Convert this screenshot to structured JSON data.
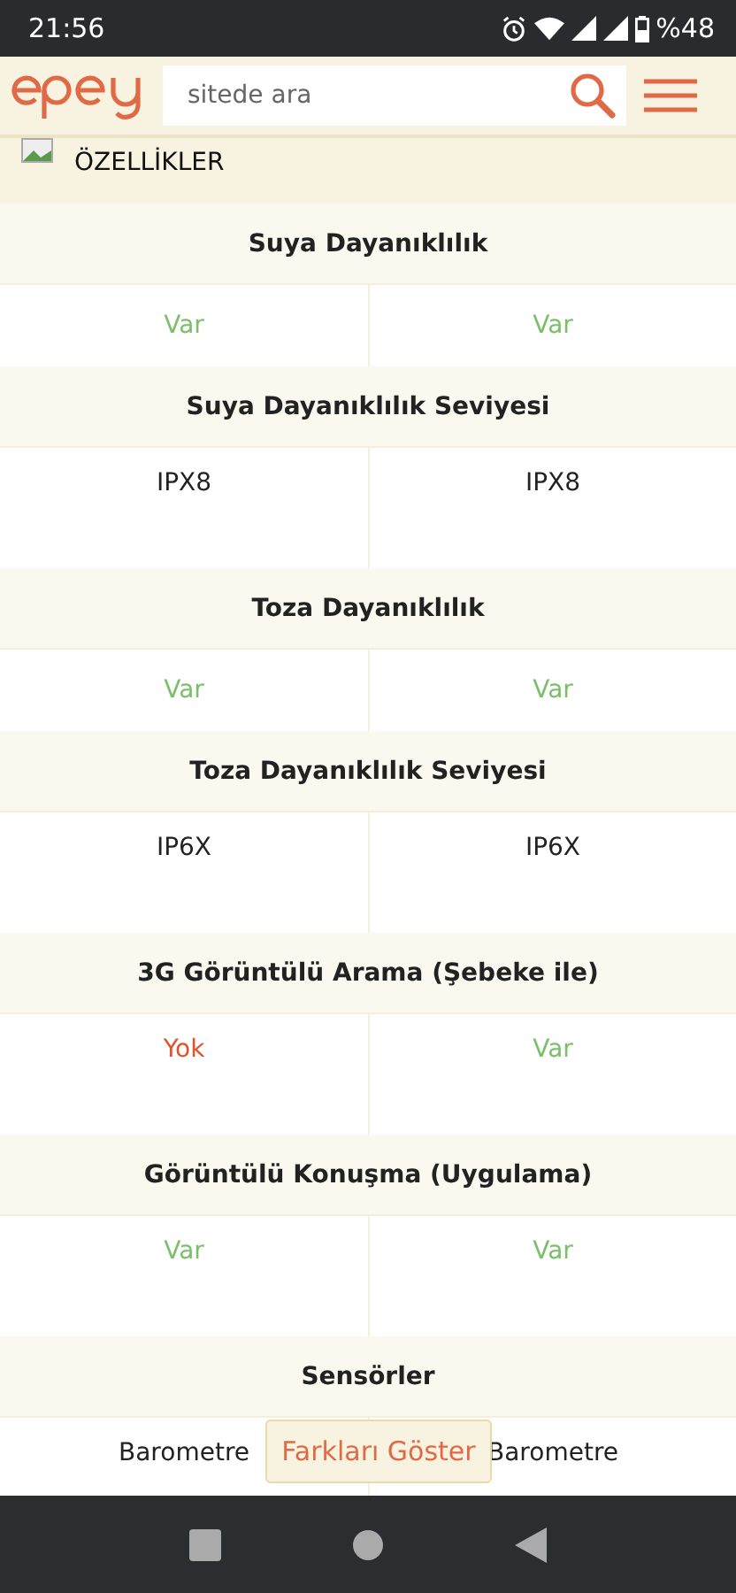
{
  "status_bar": {
    "time": "21:56",
    "battery": "%48"
  },
  "header": {
    "search": {
      "placeholder": "sitede ara"
    }
  },
  "section": {
    "title": "ÖZELLİKLER"
  },
  "features": [
    {
      "name": "Suya Dayanıklılık",
      "tall": false,
      "values": [
        {
          "kind": "yes",
          "text": "Var"
        },
        {
          "kind": "yes",
          "text": "Var"
        }
      ]
    },
    {
      "name": "Suya Dayanıklılık Seviyesi",
      "tall": true,
      "values": [
        {
          "kind": "text",
          "text": "IPX8"
        },
        {
          "kind": "text",
          "text": "IPX8"
        }
      ]
    },
    {
      "name": "Toza Dayanıklılık",
      "tall": false,
      "values": [
        {
          "kind": "yes",
          "text": "Var"
        },
        {
          "kind": "yes",
          "text": "Var"
        }
      ]
    },
    {
      "name": "Toza Dayanıklılık Seviyesi",
      "tall": true,
      "values": [
        {
          "kind": "text",
          "text": "IP6X"
        },
        {
          "kind": "text",
          "text": "IP6X"
        }
      ]
    },
    {
      "name": "3G Görüntülü Arama (Şebeke ile)",
      "tall": true,
      "values": [
        {
          "kind": "no",
          "text": "Yok"
        },
        {
          "kind": "yes",
          "text": "Var"
        }
      ]
    },
    {
      "name": "Görüntülü Konuşma (Uygulama)",
      "tall": true,
      "values": [
        {
          "kind": "yes",
          "text": "Var"
        },
        {
          "kind": "yes",
          "text": "Var"
        }
      ]
    },
    {
      "name": "Sensörler",
      "tall": true,
      "values": [
        {
          "kind": "text",
          "text": "Barometre"
        },
        {
          "kind": "text",
          "text": "Barometre"
        }
      ]
    }
  ],
  "diff_button": {
    "label": "Farkları Göster"
  }
}
